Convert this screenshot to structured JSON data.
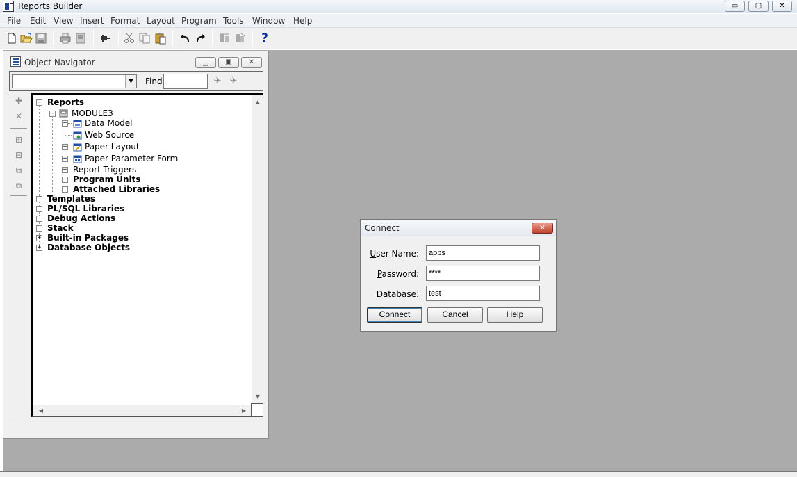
{
  "app": {
    "title": "Reports Builder"
  },
  "window_controls": {
    "minimize": "▭",
    "restore": "▢",
    "close": "✕"
  },
  "menu": [
    "File",
    "Edit",
    "View",
    "Insert",
    "Format",
    "Layout",
    "Program",
    "Tools",
    "Window",
    "Help"
  ],
  "toolbar": {
    "icons": [
      "new-icon",
      "open-icon",
      "save-icon",
      "print-icon",
      "print-preview-icon",
      "connect-icon",
      "cut-icon",
      "copy-icon",
      "paste-icon",
      "undo-icon",
      "redo-icon",
      "compile-icon",
      "run-icon",
      "help-icon"
    ],
    "help_glyph": "?"
  },
  "navigator": {
    "title": "Object Navigator",
    "find_label": "Find:",
    "find_value": "",
    "combo_value": "",
    "side_icons": [
      "create-icon",
      "delete-icon",
      "expand-icon",
      "collapse-icon",
      "expand-all-icon",
      "collapse-all-icon"
    ],
    "tree": {
      "reports": "Reports",
      "module": "MODULE3",
      "data_model": "Data Model",
      "web_source": "Web Source",
      "paper_layout": "Paper Layout",
      "paper_parameter_form": "Paper Parameter Form",
      "report_triggers": "Report Triggers",
      "program_units": "Program Units",
      "attached_libraries": "Attached Libraries",
      "templates": "Templates",
      "plsql_libraries": "PL/SQL Libraries",
      "debug_actions": "Debug Actions",
      "stack": "Stack",
      "builtin_packages": "Built-in Packages",
      "database_objects": "Database Objects"
    }
  },
  "connect_dialog": {
    "title": "Connect",
    "close_glyph": "✕",
    "username_label_u": "U",
    "username_label_rest": "ser Name:",
    "password_label_u": "P",
    "password_label_rest": "assword:",
    "database_label_u": "D",
    "database_label_rest": "atabase:",
    "username_value": "apps",
    "password_value": "****",
    "database_value": "test",
    "connect_button_u": "C",
    "connect_button_rest": "onnect",
    "cancel_button": "Cancel",
    "help_button": "Help"
  }
}
